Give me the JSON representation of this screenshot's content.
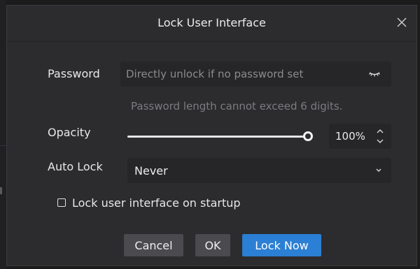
{
  "dialog": {
    "title": "Lock User Interface",
    "close_icon": "close-icon"
  },
  "password": {
    "label": "Password",
    "value": "",
    "placeholder": "Directly unlock if no password set",
    "toggle_icon": "eye-closed-icon",
    "hint": "Password length cannot exceed 6 digits."
  },
  "opacity": {
    "label": "Opacity",
    "level": 1.0,
    "display": "100%",
    "increment_icon": "chevron-up-icon",
    "decrement_icon": "chevron-down-icon"
  },
  "auto_lock": {
    "label": "Auto Lock",
    "selected": "Never",
    "chevron_icon": "chevron-down-icon"
  },
  "startup": {
    "label": "Lock user interface on startup",
    "checked": false
  },
  "buttons": {
    "cancel": "Cancel",
    "ok": "OK",
    "lock_now": "Lock Now"
  },
  "colors": {
    "dialog_bg": "#2c2c2e",
    "field_bg": "#262628",
    "secondary_button": "#4a4a4f",
    "primary_button": "#2b7fd4",
    "hint_text": "#7c7c80"
  }
}
